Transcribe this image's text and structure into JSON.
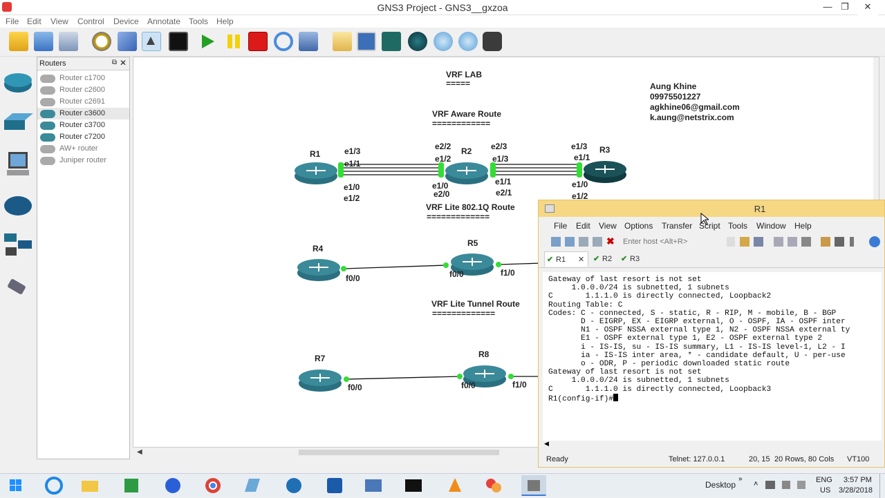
{
  "window": {
    "title": "GNS3 Project - GNS3__gxzoa",
    "min": "—",
    "max": "❐",
    "close": "✕"
  },
  "menu": [
    "File",
    "Edit",
    "View",
    "Control",
    "Device",
    "Annotate",
    "Tools",
    "Help"
  ],
  "toolbar": [
    "new-project",
    "open-project",
    "save-project",
    "snapshot",
    "start-all",
    "select",
    "console-all",
    "play",
    "pause",
    "stop",
    "reload",
    "virtualbox",
    "note",
    "screenshot-canvas",
    "terminal",
    "ellipse",
    "zoom-in",
    "zoom-out",
    "camera"
  ],
  "routers_panel": {
    "title": "Routers",
    "items": [
      "Router c1700",
      "Router c2600",
      "Router c2691",
      "Router c3600",
      "Router c3700",
      "Router c7200",
      "AW+ router",
      "Juniper router"
    ]
  },
  "canvas": {
    "note_title": "VRF LAB",
    "note_title_underline": "=====",
    "author": [
      "Aung Khine",
      "09975501227",
      "agkhine06@gmail.com",
      "k.aung@netstrix.com"
    ],
    "sections": [
      {
        "title": "VRF Aware Route",
        "underline": "============"
      },
      {
        "title": "VRF Lite 802.1Q Route",
        "underline": "============="
      },
      {
        "title": "VRF Lite Tunnel Route",
        "underline": "============="
      }
    ],
    "routers": [
      "R1",
      "R2",
      "R3",
      "R4",
      "R5",
      "R7",
      "R8"
    ],
    "interfaces": {
      "r1a": "e1/3",
      "r1b": "e1/1",
      "r1c": "e1/0",
      "r1d": "e1/2",
      "r2a": "e2/2",
      "r2b": "e1/2",
      "r2c": "e2/3",
      "r2d": "e1/3",
      "r2e": "e1/0",
      "r2f": "e2/0",
      "r2g": "e1/1",
      "r2h": "e2/1",
      "r3a": "e1/3",
      "r3b": "e1/1",
      "r3c": "e1/0",
      "r3d": "e1/2",
      "r4a": "f0/0",
      "r5a": "f0/0",
      "r5b": "f1/0",
      "r7a": "f0/0",
      "r8a": "f0/0",
      "r8b": "f1/0"
    }
  },
  "terminal": {
    "title": "R1",
    "menu": [
      "File",
      "Edit",
      "View",
      "Options",
      "Transfer",
      "Script",
      "Tools",
      "Window",
      "Help"
    ],
    "host_placeholder": "Enter host <Alt+R>",
    "tabs": [
      "R1",
      "R2",
      "R3"
    ],
    "tab_close": "✕",
    "tab_check": "✔",
    "lines": [
      "Gateway of last resort is not set",
      "",
      "     1.0.0.0/24 is subnetted, 1 subnets",
      "C       1.1.1.0 is directly connected, Loopback2",
      "",
      "Routing Table: C",
      "Codes: C - connected, S - static, R - RIP, M - mobile, B - BGP",
      "       D - EIGRP, EX - EIGRP external, O - OSPF, IA - OSPF inter",
      "       N1 - OSPF NSSA external type 1, N2 - OSPF NSSA external ty",
      "       E1 - OSPF external type 1, E2 - OSPF external type 2",
      "       i - IS-IS, su - IS-IS summary, L1 - IS-IS level-1, L2 - I",
      "       ia - IS-IS inter area, * - candidate default, U - per-use",
      "       o - ODR, P - periodic downloaded static route",
      "",
      "Gateway of last resort is not set",
      "",
      "     1.0.0.0/24 is subnetted, 1 subnets",
      "C       1.1.1.0 is directly connected, Loopback3",
      "R1(config-if)#"
    ],
    "status": {
      "ready": "Ready",
      "conn": "Telnet: 127.0.0.1",
      "pos": "20, 15",
      "size": "20 Rows, 80 Cols",
      "emu": "VT100"
    }
  },
  "taskbar": {
    "desktop": "Desktop",
    "lang": "ENG",
    "region": "US",
    "time": "3:57 PM",
    "date": "3/28/2018"
  },
  "colors": {
    "router": "#3a8a99",
    "port": "#33dd33",
    "term_title": "#f5d784"
  }
}
